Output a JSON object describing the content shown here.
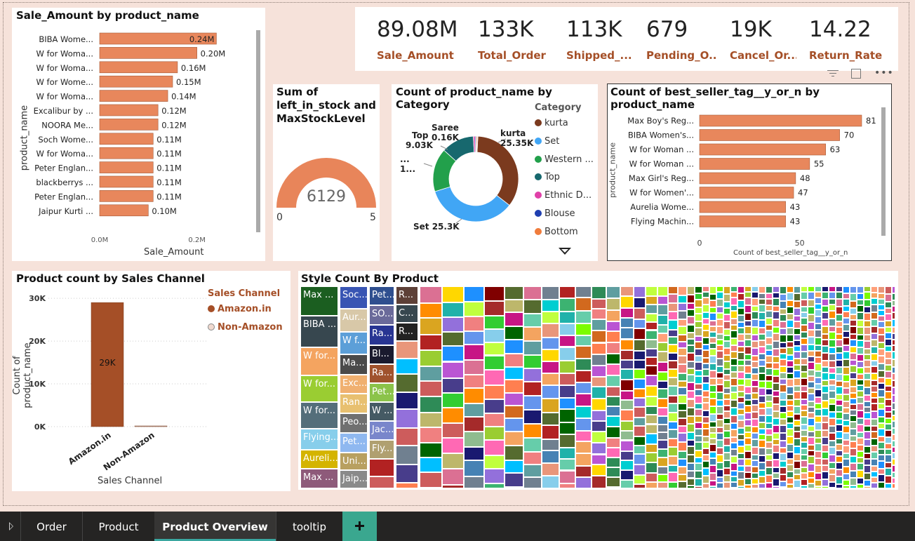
{
  "kpis": [
    {
      "value": "89.08M",
      "label": "Sale_Amount"
    },
    {
      "value": "133K",
      "label": "Total_Order"
    },
    {
      "value": "113K",
      "label": "Shipped_..."
    },
    {
      "value": "679",
      "label": "Pending_O..."
    },
    {
      "value": "19K",
      "label": "Cancel_Or..."
    },
    {
      "value": "14.22",
      "label": "Return_Rate"
    }
  ],
  "sale_chart": {
    "title": "Sale_Amount by product_name",
    "ylabel": "product_name",
    "xlabel": "Sale_Amount",
    "ticks": [
      "0.0M",
      "0.2M"
    ]
  },
  "gauge": {
    "title_l1": "Sum of",
    "title_l2": "left_in_stock and",
    "title_l3": "MaxStockLevel",
    "value": "6129",
    "min": "0",
    "max": "5"
  },
  "donut": {
    "title": "Count of product_name by Category",
    "legend_title": "Category",
    "legend": [
      {
        "label": "kurta",
        "color": "#7b3a1e"
      },
      {
        "label": "Set",
        "color": "#41a6f5"
      },
      {
        "label": "Western ...",
        "color": "#22a04b"
      },
      {
        "label": "Top",
        "color": "#17686e"
      },
      {
        "label": "Ethnic D...",
        "color": "#e040a8"
      },
      {
        "label": "Blouse",
        "color": "#1f3fb0"
      },
      {
        "label": "Bottom",
        "color": "#f07c3c"
      }
    ],
    "labels": {
      "kurta": "kurta",
      "kurta_v": "25.35K",
      "set": "Set 25.3K",
      "top": "Top",
      "top_v": "9.03K",
      "saree": "Saree",
      "saree_v": "0.16K",
      "west1": "...",
      "west2": "1..."
    }
  },
  "bestseller": {
    "title": "Count of best_seller_tag__y_or_n by product_name",
    "ylabel": "product_name",
    "xlabel": "Count of best_seller_tag__y_or_n",
    "ticks": [
      "0",
      "50"
    ]
  },
  "channel": {
    "title": "Product count by Sales Channel",
    "ylabel": "Count of product_name",
    "xlabel": "Sales Channel",
    "legend_title": "Sales Channel",
    "legend": [
      {
        "label": "Amazon.in",
        "color": "#a54f27"
      },
      {
        "label": "Non-Amazon",
        "color": "#f0d9cf"
      }
    ],
    "ticks": [
      "30K",
      "20K",
      "10K",
      "0K"
    ],
    "bar_label": "29K"
  },
  "treemap": {
    "title": "Style Count By Product",
    "cells": [
      "Max ...",
      "BIBA ...",
      "W for...",
      "W for...",
      "W for...",
      "Flying...",
      "Aureli...",
      "Max ...",
      "Soc...",
      "Aur...",
      "W f...",
      "Ma...",
      "Exc...",
      "Ran...",
      "Peo...",
      "Pet...",
      "Uni...",
      "Jaip...",
      "Pet...",
      "SO...",
      "Ra...",
      "Bl...",
      "Ra...",
      "Pet...",
      "W ...",
      "Jac...",
      "Fly...",
      "R...",
      "C...",
      "R..."
    ]
  },
  "chart_data": [
    {
      "type": "bar",
      "title": "Sale_Amount by product_name",
      "xlabel": "Sale_Amount",
      "ylabel": "product_name",
      "categories": [
        "BIBA Wome...",
        "W for Woma...",
        "W for Woma...",
        "W for Wome...",
        "W for Woma...",
        "Excalibur by ...",
        "NOORA Me...",
        "Soch Wome...",
        "W for Woma...",
        "Peter Englan...",
        "blackberrys ...",
        "Peter Englan...",
        "Jaipur Kurti ..."
      ],
      "values": [
        0.24,
        0.2,
        0.16,
        0.15,
        0.14,
        0.12,
        0.12,
        0.11,
        0.11,
        0.11,
        0.11,
        0.11,
        0.1
      ],
      "labels": [
        "0.24M",
        "0.20M",
        "0.16M",
        "0.15M",
        "0.14M",
        "0.12M",
        "0.12M",
        "0.11M",
        "0.11M",
        "0.11M",
        "0.11M",
        "0.11M",
        "0.10M"
      ],
      "xlim": [
        0,
        0.3
      ]
    },
    {
      "type": "bar",
      "title": "Count of best_seller_tag__y_or_n by product_name",
      "xlabel": "Count of best_seller_tag__y_or_n",
      "ylabel": "product_name",
      "categories": [
        "Max Boy's Reg...",
        "BIBA Women's...",
        "W for Woman ...",
        "W for Woman ...",
        "Max Girl's Reg...",
        "W for Women'...",
        "Aurelia Wome...",
        "Flying Machin..."
      ],
      "values": [
        81,
        70,
        63,
        55,
        48,
        47,
        43,
        43
      ],
      "xlim": [
        0,
        85
      ]
    },
    {
      "type": "pie",
      "title": "Count of product_name by Category",
      "categories": [
        "kurta",
        "Set",
        "Western ...",
        "Top",
        "Ethnic D...",
        "Blouse",
        "Bottom",
        "Saree"
      ],
      "values": [
        25.35,
        25.3,
        12.0,
        9.03,
        0.5,
        0.3,
        0.3,
        0.16
      ]
    },
    {
      "type": "bar",
      "title": "Product count by Sales Channel",
      "xlabel": "Sales Channel",
      "ylabel": "Count of product_name",
      "categories": [
        "Amazon.in",
        "Non-Amazon"
      ],
      "values": [
        29000,
        100
      ],
      "ylim": [
        0,
        31000
      ]
    }
  ]
}
